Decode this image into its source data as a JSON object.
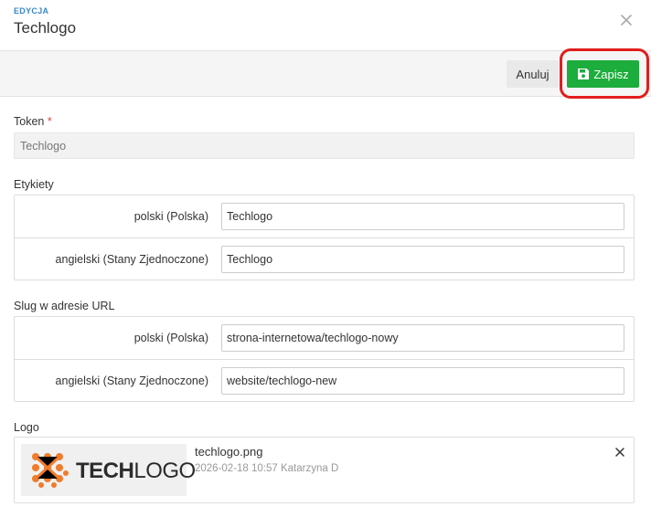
{
  "modal": {
    "kicker": "EDYCJA",
    "title": "Techlogo",
    "close_icon": "close-icon"
  },
  "toolbar": {
    "cancel_label": "Anuluj",
    "save_label": "Zapisz",
    "save_icon": "floppy-disk-icon",
    "save_color": "#1cad3c",
    "highlight_color": "#e21d1d"
  },
  "token": {
    "label": "Token",
    "required_mark": "*",
    "value": "Techlogo"
  },
  "labels_section": {
    "label": "Etykiety",
    "rows": [
      {
        "lang": "polski (Polska)",
        "value": "Techlogo"
      },
      {
        "lang": "angielski (Stany Zjednoczone)",
        "value": "Techlogo"
      }
    ]
  },
  "slug_section": {
    "label": "Slug w adresie URL",
    "rows": [
      {
        "lang": "polski (Polska)",
        "value": "strona-internetowa/techlogo-nowy"
      },
      {
        "lang": "angielski (Stany Zjednoczone)",
        "value": "website/techlogo-new"
      }
    ]
  },
  "logo": {
    "label": "Logo",
    "brand_bold": "TECH",
    "brand_light": "LOGO",
    "brand_color": "#f07c2b",
    "file_name": "techlogo.png",
    "file_meta": "2026-02-18 10:57 Katarzyna D",
    "remove_icon": "close-icon"
  }
}
